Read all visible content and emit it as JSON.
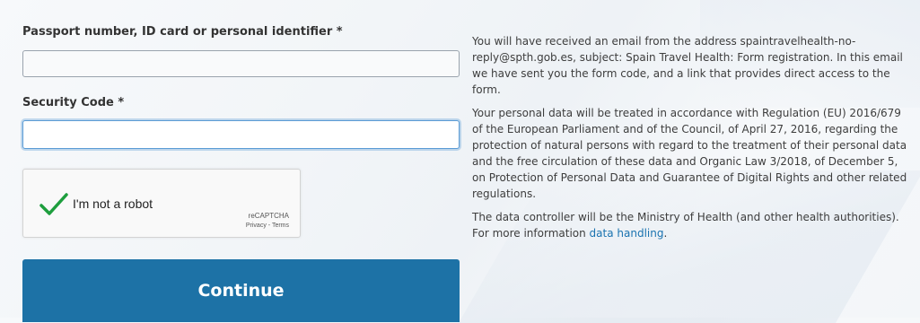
{
  "form": {
    "passport_label": "Passport number, ID card or personal identifier *",
    "passport_value": "",
    "security_label": "Security Code *",
    "security_value": "",
    "continue_label": "Continue"
  },
  "captcha": {
    "label": "I'm not a robot",
    "checked": true,
    "brand": "reCAPTCHA",
    "privacy": "Privacy",
    "separator": " - ",
    "terms": "Terms",
    "check_icon": "checkmark-icon"
  },
  "info": {
    "paragraph1": "You will have received an email from the address spaintravelhealth-no-reply@spth.gob.es, subject: Spain Travel Health: Form registration. In this email we have sent you the form code, and a link that provides direct access to the form.",
    "paragraph2": "Your personal data will be treated in accordance with Regulation (EU) 2016/679 of the European Parliament and of the Council, of April 27, 2016, regarding the protection of natural persons with regard to the treatment of their personal data and the free circulation of these data and Organic Law 3/2018, of December 5, on Protection of Personal Data and Guarantee of Digital Rights and other related regulations.",
    "paragraph3_text": "The data controller will be the Ministry of Health (and other health authorities). For more information ",
    "paragraph3_link": "data handling",
    "paragraph3_end": "."
  },
  "colors": {
    "button": "#1d72a6",
    "link": "#1a73b0",
    "check": "#1e9e3e",
    "focus": "#5a9bd5"
  }
}
